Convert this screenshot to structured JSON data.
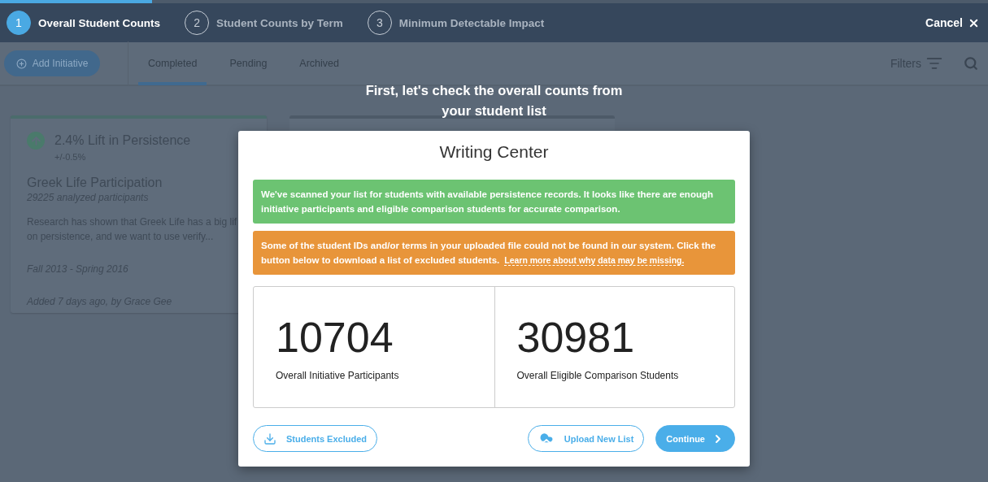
{
  "progress": {
    "level": 0.154
  },
  "steps": [
    {
      "number": "1",
      "label": "Overall Student Counts",
      "selected": true
    },
    {
      "number": "2",
      "label": "Student Counts by Term",
      "selected": false
    },
    {
      "number": "3",
      "label": "Minimum Detectable Impact",
      "selected": false
    }
  ],
  "cancel": {
    "label": "Cancel"
  },
  "toolbar": {
    "add_button": "Add Initiative",
    "tabs": [
      {
        "label": "Completed",
        "selected": true
      },
      {
        "label": "Pending",
        "selected": false
      },
      {
        "label": "Archived",
        "selected": false
      }
    ],
    "filters": "Filters"
  },
  "card": {
    "lift": "2.4% Lift in Persistence",
    "margin": "+/-0.5%",
    "title": "Greek Life Participation",
    "participants": "29225 analyzed participants",
    "description_lines": [
      "Research has shown that Greek Life has a big lif",
      "on persistence, and we want to use verify..."
    ],
    "dates": "Fall 2013 - Spring 2016",
    "added": "Added 7 days ago, by Grace Gee"
  },
  "overlay_heading": "First, let's check the overall counts from your student list",
  "modal": {
    "title": "Writing Center",
    "alerts": [
      {
        "kind": "success",
        "text": "We've scanned your list for students with available persistence records. It looks like there are enough initiative participants and eligible comparison students for accurate comparison."
      },
      {
        "kind": "warning",
        "text": "Some of the student IDs and/or terms in your uploaded file could not be found in our system. Click the button below to download a list of excluded students.",
        "link": "Learn more about why data may be missing."
      }
    ],
    "stats": [
      {
        "value": "10704",
        "label": "Overall Initiative Participants"
      },
      {
        "value": "30981",
        "label": "Overall Eligible Comparison Students"
      }
    ],
    "buttons": [
      {
        "kind": "download",
        "label": "Students Excluded"
      },
      {
        "kind": "upload",
        "label": "Upload New List"
      },
      {
        "kind": "continue",
        "label": "Continue"
      }
    ]
  }
}
